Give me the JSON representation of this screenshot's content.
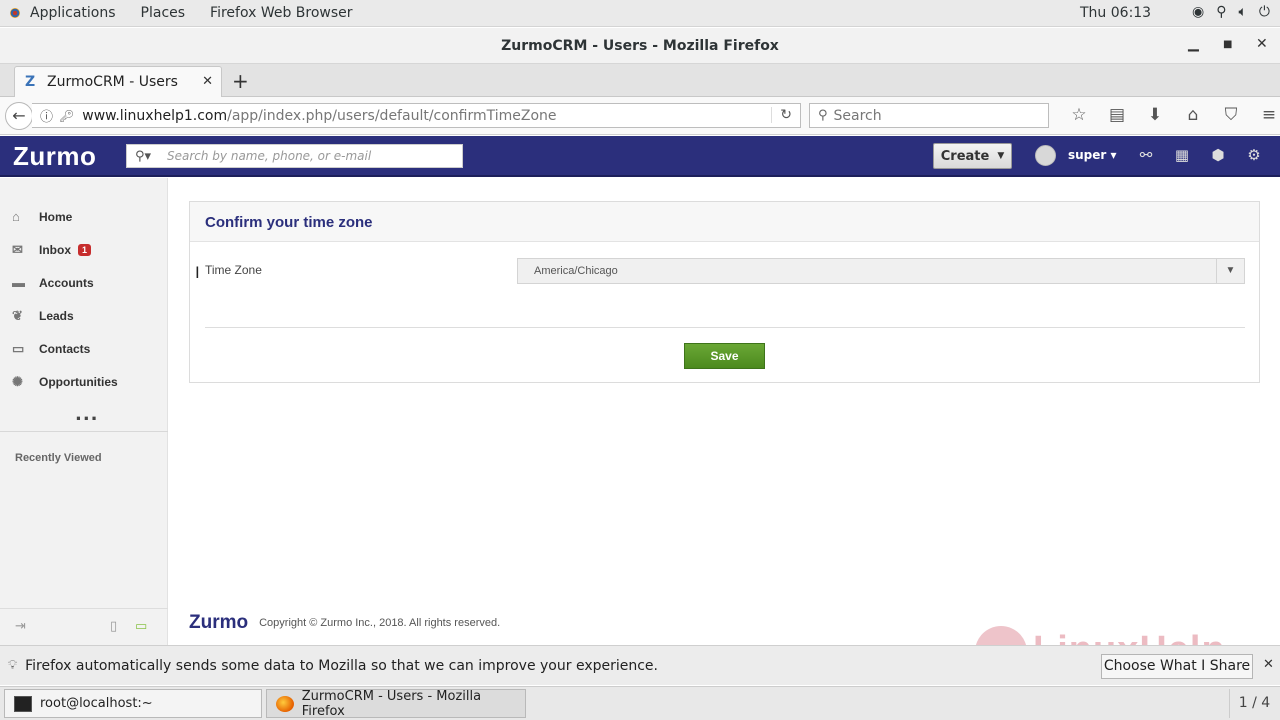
{
  "topbar": {
    "applications": "Applications",
    "places": "Places",
    "browser": "Firefox Web Browser",
    "clock": "Thu 06:13"
  },
  "window": {
    "title": "ZurmoCRM - Users - Mozilla Firefox"
  },
  "tab": {
    "label": "ZurmoCRM - Users"
  },
  "navbar": {
    "url_host": "www.linuxhelp1.com",
    "url_path": "/app/index.php/users/default/confirmTimeZone",
    "search_placeholder": "Search"
  },
  "zurmo": {
    "logo": "Zurmo",
    "search_placeholder": "Search by name, phone, or e-mail",
    "create_label": "Create",
    "username": "super"
  },
  "sidebar": {
    "items": [
      {
        "label": "Home",
        "icon": "home-icon"
      },
      {
        "label": "Inbox",
        "icon": "mail-icon",
        "badge": "1"
      },
      {
        "label": "Accounts",
        "icon": "folder-icon"
      },
      {
        "label": "Leads",
        "icon": "leaf-icon"
      },
      {
        "label": "Contacts",
        "icon": "contact-card-icon"
      },
      {
        "label": "Opportunities",
        "icon": "lightbulb-icon"
      }
    ],
    "more": "...",
    "recently_viewed": "Recently Viewed"
  },
  "form": {
    "title": "Confirm your time zone",
    "timezone_label": "Time Zone",
    "timezone_value": "America/Chicago",
    "save_label": "Save"
  },
  "footer": {
    "logo": "Zurmo",
    "copyright": "Copyright © Zurmo Inc., 2018. All rights reserved."
  },
  "notification": {
    "message": "Firefox automatically sends some data to Mozilla so that we can improve your experience.",
    "button": "Choose What I Share"
  },
  "taskbar": {
    "terminal": "root@localhost:~",
    "firefox": "ZurmoCRM - Users - Mozilla Firefox",
    "workspace": "1 / 4"
  },
  "watermark": "LinuxHelp",
  "colors": {
    "zurmo_header": "#2b2f7c",
    "save_button": "#5a9a28",
    "badge": "#c62d2d"
  }
}
